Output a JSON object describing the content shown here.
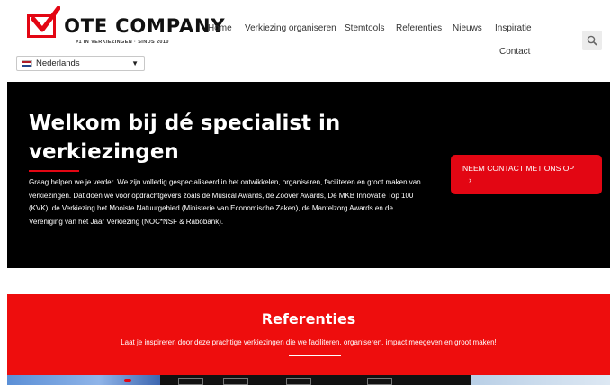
{
  "brand": {
    "name_rest": "OTE COMPANY",
    "tagline": "#1 IN VERKIEZINGEN · SINDS 2010",
    "accent": "#e30613"
  },
  "language": {
    "selected": "Nederlands"
  },
  "nav": {
    "items": [
      {
        "label": "Home"
      },
      {
        "label": "Verkiezing organiseren"
      },
      {
        "label": "Stemtools"
      },
      {
        "label": "Referenties"
      },
      {
        "label": "Nieuws"
      },
      {
        "label": "Inspiratie"
      },
      {
        "label": "Contact"
      }
    ],
    "search_icon": "search-icon"
  },
  "hero": {
    "title": "Welkom bij dé specialist in verkiezingen",
    "text": "Graag helpen we je verder. We zijn volledig gespecialiseerd in het ontwikkelen, organiseren, faciliteren en groot maken van verkiezingen. Dat doen we voor opdrachtgevers zoals de Musical Awards, de Zoover Awards, De MKB Innovatie Top 100 (KVK), de Verkiezing het Mooiste Natuurgebied (Ministerie van Economische Zaken), de Mantelzorg Awards en de Vereniging van het Jaar Verkiezing (NOC*NSF & Rabobank).",
    "cta_label": "NEEM CONTACT MET ONS OP",
    "cta_arrow": "›"
  },
  "referenties": {
    "title": "Referenties",
    "subtitle": "Laat je inspireren door deze prachtige verkiezingen die we faciliteren, organiseren, impact meegeven en groot maken!"
  }
}
